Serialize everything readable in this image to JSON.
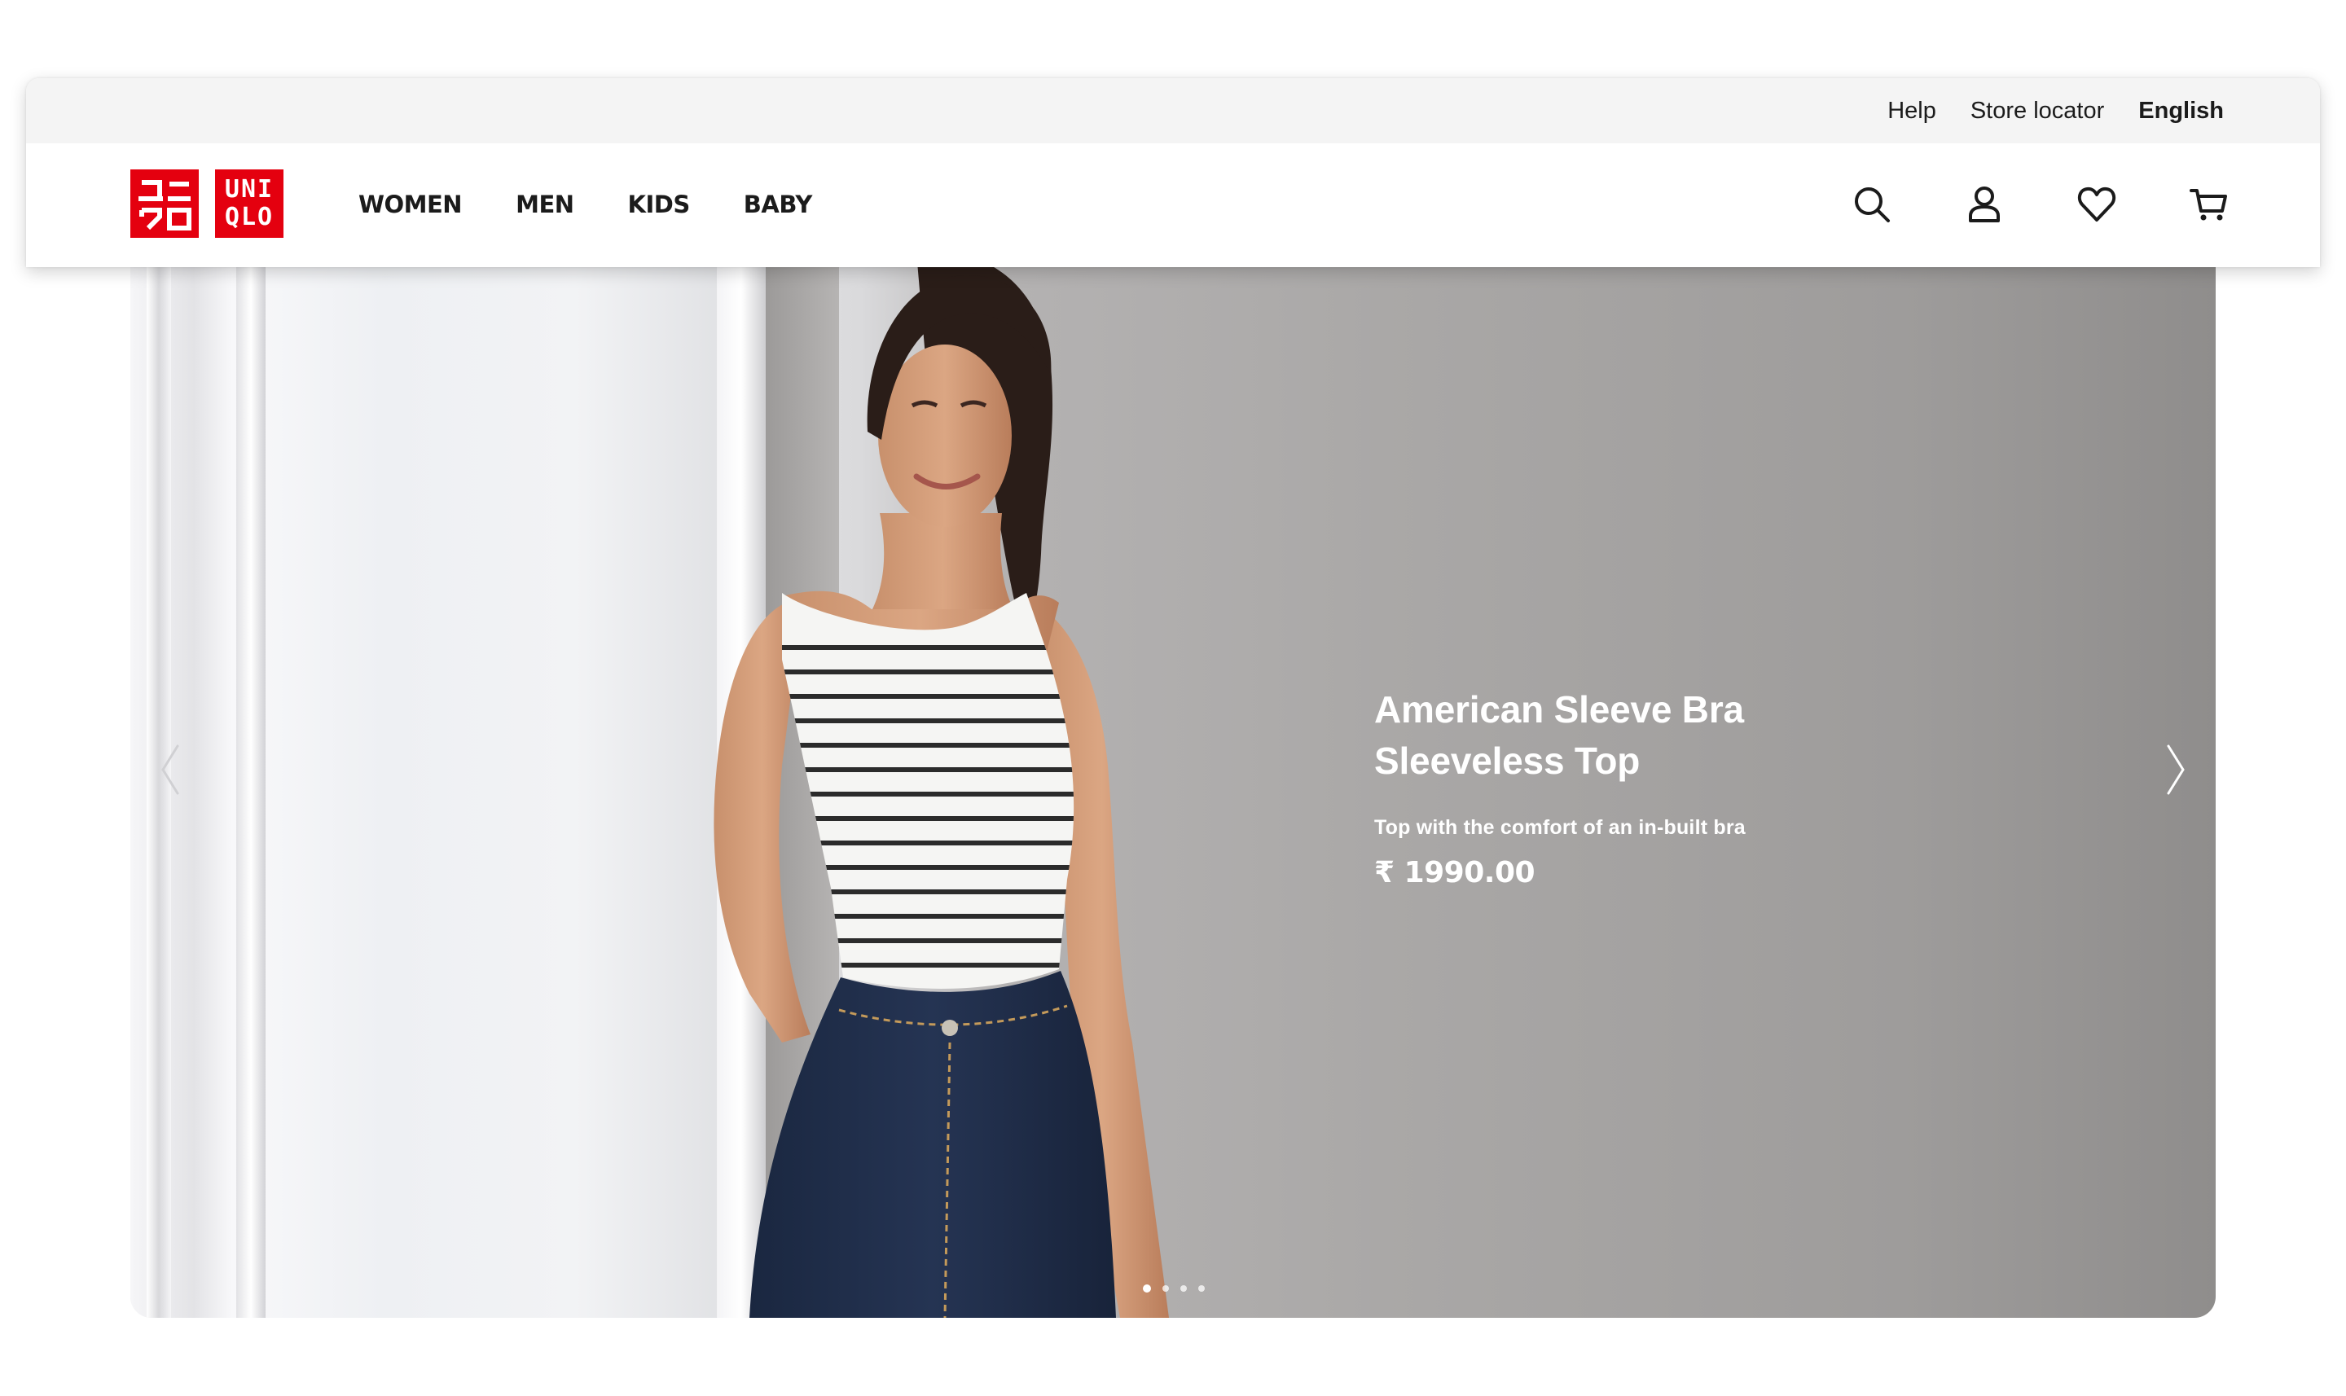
{
  "utility": {
    "help": "Help",
    "store_locator": "Store locator",
    "language": "English"
  },
  "logo": {
    "left_text": "ユニクロ",
    "right_line1": "UNI",
    "right_line2": "QLO",
    "brand_color": "#e4000f"
  },
  "nav": {
    "items": [
      {
        "label": "WOMEN"
      },
      {
        "label": "MEN"
      },
      {
        "label": "KIDS"
      },
      {
        "label": "BABY"
      }
    ],
    "icons": [
      "search-icon",
      "account-icon",
      "wishlist-heart-icon",
      "cart-icon"
    ]
  },
  "hero": {
    "title_line1": "American Sleeve Bra",
    "title_line2": "Sleeveless Top",
    "subtitle": "Top with the comfort of an in-built bra",
    "price": "₹ 1990.00",
    "slide_count": 4,
    "active_slide": 1
  }
}
